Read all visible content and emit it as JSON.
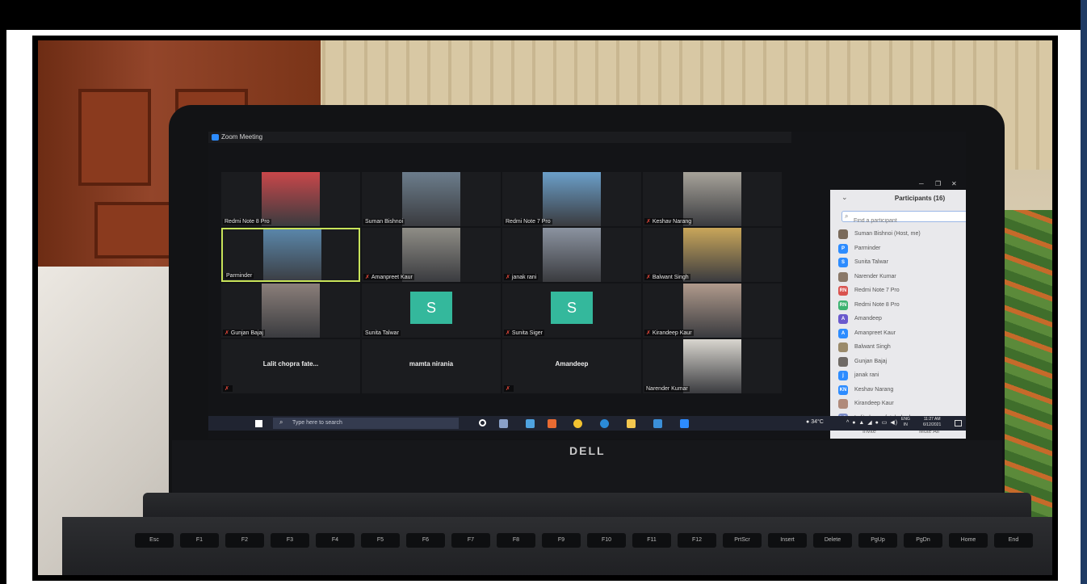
{
  "window": {
    "app_title": "Zoom Meeting"
  },
  "tiles": [
    {
      "name": "Redmi Note 8 Pro",
      "muted": false,
      "kind": "video",
      "bg": "#c9474a"
    },
    {
      "name": "Suman Bishnoi",
      "muted": false,
      "kind": "video",
      "bg": "#6c7d8c"
    },
    {
      "name": "Redmi Note 7 Pro",
      "muted": false,
      "kind": "video",
      "bg": "#6b9fc9"
    },
    {
      "name": "Keshav Narang",
      "muted": true,
      "kind": "video",
      "bg": "#a7a39a"
    },
    {
      "name": "Parminder",
      "muted": false,
      "kind": "video",
      "bg": "#5a86a9",
      "active": true
    },
    {
      "name": "Amanpreet Kaur",
      "muted": true,
      "kind": "video",
      "bg": "#8f8d86"
    },
    {
      "name": "janak rani",
      "muted": true,
      "kind": "video",
      "bg": "#8b93a0"
    },
    {
      "name": "Balwant Singh",
      "muted": true,
      "kind": "video",
      "bg": "#c9a65a"
    },
    {
      "name": "Gunjan Bajaj",
      "muted": true,
      "kind": "video",
      "bg": "#8b7f7a"
    },
    {
      "name": "Sunita Talwar",
      "muted": false,
      "kind": "avatar",
      "letter": "S"
    },
    {
      "name": "Sunita Siger",
      "muted": true,
      "kind": "avatar",
      "letter": "S"
    },
    {
      "name": "Kirandeep Kaur",
      "muted": true,
      "kind": "video",
      "bg": "#b09a8c"
    },
    {
      "name": "Lalit chopra fate...",
      "muted": true,
      "kind": "text"
    },
    {
      "name": "mamta nirania",
      "muted": false,
      "kind": "text"
    },
    {
      "name": "Amandeep",
      "muted": true,
      "kind": "text"
    },
    {
      "name": "Narender Kumar",
      "muted": false,
      "kind": "video",
      "bg": "#d9d6cf"
    }
  ],
  "participants_panel": {
    "title": "Participants (16)",
    "search_placeholder": "Find a participant",
    "invite_label": "Invite",
    "mute_all_label": "Mute All",
    "people": [
      {
        "name": "Suman Bishnoi (Host, me)",
        "initials": "",
        "color": "#7a6a5a",
        "mic_off": false,
        "cam_off": false
      },
      {
        "name": "Parminder",
        "initials": "P",
        "color": "#2d8cff",
        "mic_off": false,
        "cam_off": false
      },
      {
        "name": "Sunita Talwar",
        "initials": "S",
        "color": "#2d8cff",
        "mic_off": false,
        "cam_off": true
      },
      {
        "name": "Narender Kumar",
        "initials": "",
        "color": "#8a7868",
        "mic_off": false,
        "cam_off": true
      },
      {
        "name": "Redmi Note 7 Pro",
        "initials": "RN",
        "color": "#d9534f",
        "mic_off": false,
        "cam_off": false
      },
      {
        "name": "Redmi Note 8 Pro",
        "initials": "RN",
        "color": "#3cb371",
        "mic_off": false,
        "cam_off": false
      },
      {
        "name": "Amandeep",
        "initials": "A",
        "color": "#6a5acd",
        "mic_off": true,
        "cam_off": true
      },
      {
        "name": "Amanpreet Kaur",
        "initials": "A",
        "color": "#2d8cff",
        "mic_off": true,
        "cam_off": false
      },
      {
        "name": "Balwant Singh",
        "initials": "",
        "color": "#9a8a6a",
        "mic_off": true,
        "cam_off": false
      },
      {
        "name": "Gunjan Bajaj",
        "initials": "",
        "color": "#6f6a66",
        "mic_off": true,
        "cam_off": false
      },
      {
        "name": "janak rani",
        "initials": "j",
        "color": "#2d8cff",
        "mic_off": true,
        "cam_off": false
      },
      {
        "name": "Keshav Narang",
        "initials": "KN",
        "color": "#2d8cff",
        "mic_off": true,
        "cam_off": false
      },
      {
        "name": "Kirandeep Kaur",
        "initials": "",
        "color": "#b08a7a",
        "mic_off": true,
        "cam_off": false
      },
      {
        "name": "Lalit chopra fatehabad",
        "initials": "LC",
        "color": "#7b8cc9",
        "mic_off": true,
        "cam_off": true
      }
    ]
  },
  "taskbar": {
    "search_placeholder": "Type here to search",
    "weather": "34°C",
    "language_top": "ENG",
    "language_bottom": "IN",
    "time": "11:27 AM",
    "date": "6/12/2021"
  },
  "hardware": {
    "brand": "DELL"
  }
}
